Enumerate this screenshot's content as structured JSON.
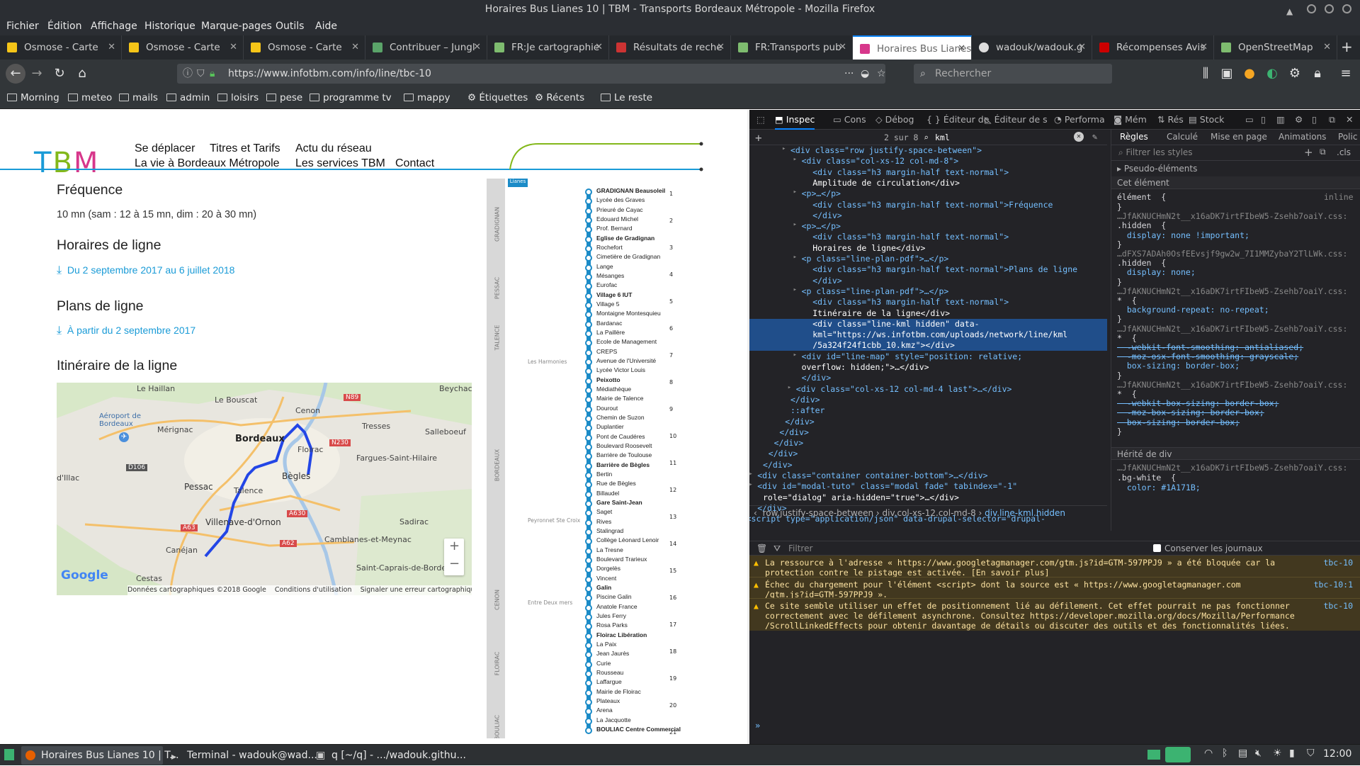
{
  "window": {
    "title": "Horaires Bus Lianes 10 | TBM - Transports Bordeaux Métropole - Mozilla Firefox"
  },
  "menu": [
    "Fichier",
    "Édition",
    "Affichage",
    "Historique",
    "Marque-pages",
    "Outils",
    "Aide"
  ],
  "tabs": [
    {
      "label": "Osmose - Carte",
      "color": "#f5c518"
    },
    {
      "label": "Osmose - Carte",
      "color": "#f5c518"
    },
    {
      "label": "Osmose - Carte",
      "color": "#f5c518"
    },
    {
      "label": "Contribuer – Jungl",
      "color": "#5aa469"
    },
    {
      "label": "FR:Je cartographie",
      "color": "#7ebc6f"
    },
    {
      "label": "Résultats de reche",
      "color": "#c33"
    },
    {
      "label": "FR:Transports pub",
      "color": "#7ebc6f"
    },
    {
      "label": "Horaires Bus Lianes",
      "color": "#d7378b",
      "active": true
    },
    {
      "label": "wadouk/wadouk.g",
      "color": "#ddd"
    },
    {
      "label": "Récompenses Avis",
      "color": "#c00"
    },
    {
      "label": "OpenStreetMap",
      "color": "#7ebc6f"
    }
  ],
  "nav": {
    "url": "https://www.infotbm.com/info/line/tbc-10",
    "url_domain": "infotbm.com",
    "search_placeholder": "Rechercher"
  },
  "bookmarks": [
    "Morning",
    "meteo",
    "mails",
    "admin",
    "loisirs",
    "pese",
    "programme tv",
    "mappy",
    "Étiquettes",
    "Récents",
    "Le reste"
  ],
  "site": {
    "logo": "TBM",
    "nav_row1": [
      "Se déplacer",
      "Titres et Tarifs",
      "Actu du réseau"
    ],
    "nav_row2": [
      "La vie à Bordeaux Métropole",
      "Les services TBM",
      "Contact"
    ],
    "freq_title": "Fréquence",
    "freq_text": "10 mn (sam : 12 à 15 mn, dim : 20 à 30 mn)",
    "horaires_title": "Horaires de ligne",
    "horaires_link": "Du 2 septembre 2017 au 6 juillet 2018",
    "plans_title": "Plans de ligne",
    "plans_link": "À partir du 2 septembre 2017",
    "itin_title": "Itinéraire de la ligne"
  },
  "map": {
    "labels": [
      "Le Haillan",
      "Le Bouscat",
      "Cenon",
      "Beychac",
      "Aéroport de Bordeaux",
      "Mérignac",
      "Bordeaux",
      "Tresses",
      "Salleboeuf",
      "Floirac",
      "Fargues-Saint-Hilaire",
      "d'Illac",
      "Pessac",
      "Talence",
      "Bègles",
      "Villenave-d'Ornon",
      "Sadirac",
      "Camblanes-et-Meynac",
      "Canéjan",
      "Cestas",
      "Saint-Caprais-de-Borde"
    ],
    "roads": [
      "N89",
      "N230",
      "D106",
      "A63",
      "A630",
      "A62"
    ],
    "google": "Google",
    "footer": [
      "Données cartographiques ©2018 Google",
      "Conditions d'utilisation",
      "Signaler une erreur cartographique"
    ],
    "zoom_in": "+",
    "zoom_out": "−"
  },
  "scheme": {
    "badge": "Lianes",
    "zones": [
      "GRADIGNAN",
      "PESSAC",
      "TALENCE",
      "BORDEAUX",
      "CENON",
      "FLOIRAC",
      "BOULIAC"
    ],
    "stops": [
      "GRADIGNAN Beausoleil",
      "Lycée des Graves",
      "Prieuré de Cayac",
      "Edouard Michel",
      "Prof. Bernard",
      "Eglise de Gradignan",
      "Rochefort",
      "Cimetière de Gradignan",
      "Lange",
      "Mésanges",
      "Eurofac",
      "Village 6 IUT",
      "Village 5",
      "Montaigne Montesquieu",
      "Bardanac",
      "La Paillère",
      "Ecole de Management",
      "CREPS",
      "Avenue de l'Université",
      "Lycée Victor Louis",
      "Peixotto",
      "Médiathèque",
      "Mairie de Talence",
      "Dourout",
      "Chemin de Suzon",
      "Duplantier",
      "Pont de Caudéres",
      "Boulevard Roosevelt",
      "Barrière de Toulouse",
      "Barrière de Bègles",
      "Bertin",
      "Rue de Bègles",
      "Billaudel",
      "Gare Saint-Jean",
      "Saget",
      "Rives",
      "Stalingrad",
      "Collège Léonard Lenoir",
      "La Tresne",
      "Boulevard Trarieux",
      "Dorgelès",
      "Vincent",
      "Galin",
      "Piscine Galin",
      "Anatole France",
      "Jules Ferry",
      "Rosa Parks",
      "Floirac Libération",
      "La Paix",
      "Jean Jaurès",
      "Curie",
      "Rousseau",
      "Laffargue",
      "Mairie de Floirac",
      "Plateaux",
      "Arena",
      "La Jacquotte",
      "BOULIAC Centre Commercial"
    ],
    "numbers": [
      "1",
      "2",
      "3",
      "4",
      "5",
      "6",
      "7",
      "8",
      "9",
      "10",
      "11",
      "12",
      "13",
      "14",
      "15",
      "16",
      "17",
      "18",
      "19",
      "20",
      "21"
    ],
    "side_notes": [
      "Les Harmonies",
      "Peyronnet Ste Croix",
      "Entre Deux mers"
    ]
  },
  "devtools": {
    "tabs": [
      "Inspec",
      "Cons",
      "Débog",
      "Éditeur de",
      "Éditeur de s",
      "Performa",
      "Mém",
      "Rés",
      "Stock"
    ],
    "search_count": "2 sur 8",
    "search_value": "kml",
    "markup": [
      "<div class=\"row justify-space-between\">",
      "<div class=\"col-xs-12 col-md-8\">",
      "<div class=\"h3 margin-half text-normal\">",
      "Amplitude de circulation</div>",
      "<p>…</p>",
      "<div class=\"h3 margin-half text-normal\">Fréquence",
      "</div>",
      "<p>…</p>",
      "<div class=\"h3 margin-half text-normal\">",
      "Horaires de ligne</div>",
      "<p class=\"line-plan-pdf\">…</p>",
      "<div class=\"h3 margin-half text-normal\">Plans de ligne",
      "</div>",
      "<p class=\"line-plan-pdf\">…</p>",
      "<div class=\"h3 margin-half text-normal\">",
      "Itinéraire de la ligne</div>",
      "<div class=\"line-kml hidden\" data-",
      "kml=\"https://ws.infotbm.com/uploads/network/line/kml",
      "/5a324f24f1cbb_10.kmz\"></div>",
      "<div id=\"line-map\" style=\"position: relative;",
      "overflow: hidden;\">…</div>",
      "</div>",
      "<div class=\"col-xs-12 col-md-4 last\">…</div>",
      "</div>",
      "::after",
      "</div>",
      "</div>",
      "</div>",
      "</div>",
      "</div>",
      "<div class=\"container container-bottom\">…</div>",
      "<div id=\"modal-tuto\" class=\"modal fade\" tabindex=\"-1\"",
      "role=\"dialog\" aria-hidden=\"true\">…</div>",
      "</div>",
      "<script type=\"application/json\" data-drupal-selector=\"drupal-"
    ],
    "breadcrumb": [
      "row.justify-space-between",
      "div.col-xs-12.col-md-8",
      "div.line-kml.hidden"
    ],
    "rules_tabs": [
      "Règles",
      "Calculé",
      "Mise en page",
      "Animations",
      "Polic"
    ],
    "filter_placeholder": "Filtrer les styles",
    "cls_label": ".cls",
    "pseudo": "Pseudo-éléments",
    "this_element": "Cet élément",
    "element_rule": "élément  {",
    "inline": "inline",
    "herite": "Hérité de div",
    "rules": [
      "}",
      "…JfAKNUCHmN2t__x16aDK7irtFIbeW5-Zsehb7oaiY.css:",
      ".hidden  {",
      "  display: none !important;",
      "}",
      "…dFXS7ADAh0OsfEEvsjf9gw2w_7I1MMZybaY2TlLWk.css:",
      ".hidden  {",
      "  display: none;",
      "}",
      "…JfAKNUCHmN2t__x16aDK7irtFIbeW5-Zsehb7oaiY.css:",
      "*  {",
      "  background-repeat: no-repeat;",
      "}",
      "…JfAKNUCHmN2t__x16aDK7irtFIbeW5-Zsehb7oaiY.css:",
      "*  {",
      "  -webkit-font-smoothing: antialiased;",
      "  -moz-osx-font-smoothing: grayscale;",
      "  box-sizing: border-box;",
      "}",
      "…JfAKNUCHmN2t__x16aDK7irtFIbeW5-Zsehb7oaiY.css:",
      "*  {",
      "  -webkit-box-sizing: border-box;",
      "  -moz-box-sizing: border-box;",
      "  box-sizing: border-box;",
      "}"
    ],
    "inherit_rule": [
      "…JfAKNUCHmN2t__x16aDK7irtFIbeW5-Zsehb7oaiY.css:",
      ".bg-white  {",
      "  color: #1A171B;"
    ],
    "console_filter": "Filtrer",
    "keep_logs": "Conserver les journaux",
    "console": [
      {
        "text": "La ressource à l'adresse « https://www.googletagmanager.com/gtm.js?id=GTM-597PPJ9 » a été bloquée car la\nprotection contre le pistage est activée. [En savoir plus]",
        "src": "tbc-10"
      },
      {
        "text": "Échec du chargement pour l'élément <script> dont la source est « https://www.googletagmanager.com\n/gtm.js?id=GTM-597PPJ9 ».",
        "src": "tbc-10:1"
      },
      {
        "text": "Ce site semble utiliser un effet de positionnement lié au défilement. Cet effet pourrait ne pas fonctionner\ncorrectement avec le défilement asynchrone. Consultez https://developer.mozilla.org/docs/Mozilla/Performance\n/ScrollLinkedEffects pour obtenir davantage de détails ou discuter des outils et des fonctionnalités liées.",
        "src": "tbc-10"
      }
    ]
  },
  "taskbar": {
    "tasks": [
      "Horaires Bus Lianes 10 | T...",
      "Terminal - wadouk@wad...",
      "q [~/q] - .../wadouk.githu..."
    ],
    "clock": "12:00"
  }
}
